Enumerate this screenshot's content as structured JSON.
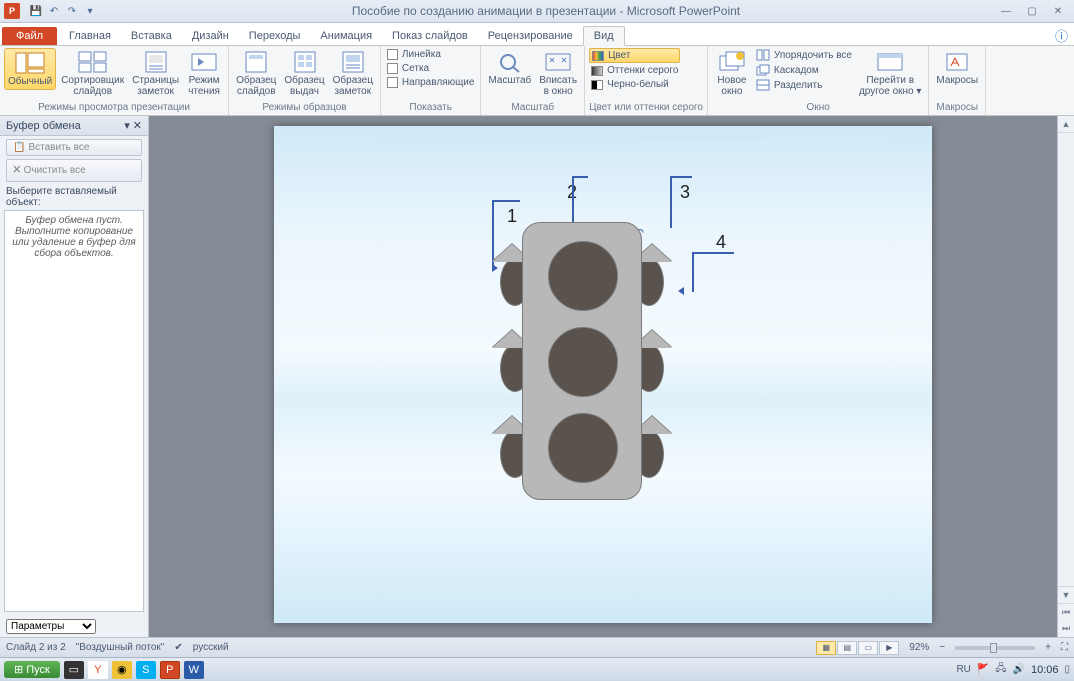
{
  "titlebar": {
    "doc_title": "Пособие по созданию анимации в презентации - Microsoft PowerPoint"
  },
  "tabs": {
    "file": "Файл",
    "items": [
      "Главная",
      "Вставка",
      "Дизайн",
      "Переходы",
      "Анимация",
      "Показ слайдов",
      "Рецензирование",
      "Вид"
    ],
    "active_index": 7
  },
  "ribbon": {
    "g_views": {
      "label": "Режимы просмотра презентации",
      "normal": "Обычный",
      "sorter": "Сортировщик\nслайдов",
      "notes": "Страницы\nзаметок",
      "reading": "Режим\nчтения"
    },
    "g_masters": {
      "label": "Режимы образцов",
      "slide": "Образец\nслайдов",
      "handout": "Образец\nвыдач",
      "notesm": "Образец\nзаметок"
    },
    "g_show": {
      "label": "Показать",
      "ruler": "Линейка",
      "grid": "Сетка",
      "guides": "Направляющие"
    },
    "g_zoom": {
      "label": "Масштаб",
      "zoom": "Масштаб",
      "fit": "Вписать\nв окно"
    },
    "g_color": {
      "label": "Цвет или оттенки серого",
      "color": "Цвет",
      "gray": "Оттенки серого",
      "bw": "Черно-белый"
    },
    "g_window": {
      "label": "Окно",
      "new": "Новое\nокно",
      "arrange": "Упорядочить все",
      "cascade": "Каскадом",
      "split": "Разделить",
      "switch": "Перейти в\nдругое окно"
    },
    "g_macros": {
      "label": "Макросы",
      "macros": "Макросы"
    }
  },
  "taskpane": {
    "title": "Буфер обмена",
    "paste_all": "Вставить все",
    "clear_all": "Очистить все",
    "prompt": "Выберите вставляемый объект:",
    "empty_msg": "Буфер обмена пуст.\nВыполните копирование или удаление в буфер для сбора объектов.",
    "options": "Параметры"
  },
  "slide": {
    "labels": {
      "1": "1",
      "2": "2",
      "3": "3",
      "4": "4"
    }
  },
  "statusbar": {
    "slide_info": "Слайд 2 из 2",
    "theme": "\"Воздушный поток\"",
    "lang": "русский",
    "zoom": "92%"
  },
  "taskbar": {
    "start": "Пуск",
    "lang": "RU",
    "time": "10:06"
  }
}
